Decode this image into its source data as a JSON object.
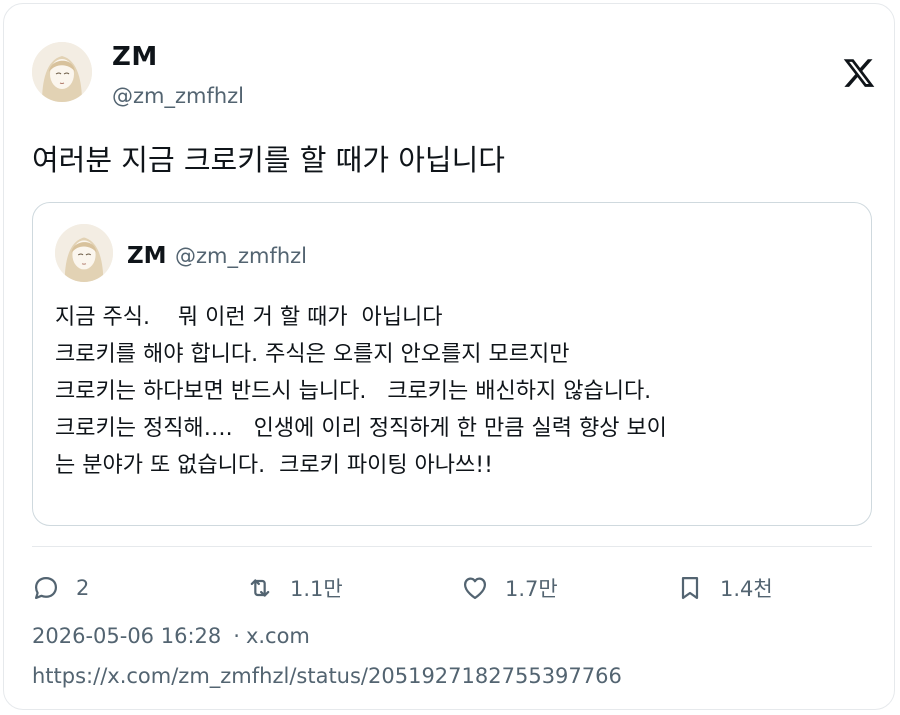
{
  "tweet": {
    "author_name": "ZM",
    "author_handle": "@zm_zmfhzl",
    "text": "여러분 지금 크로키를 할 때가 아닙니다"
  },
  "quote": {
    "author_name": "ZM",
    "author_handle": "@zm_zmfhzl",
    "lines": [
      "지금 주식.    뭐 이런 거 할 때가  아닙니다",
      "크로키를 해야 합니다. 주식은 오를지 안오를지 모르지만",
      "크로키는 하다보면 반드시 늡니다.   크로키는 배신하지 않습니다.",
      "크로키는 정직해….   인생에 이리 정직하게 한 만큼 실력 향상 보이",
      "는 분야가 또 없습니다.  크로키 파이팅 아나쓰!!"
    ]
  },
  "actions": {
    "replies": "2",
    "retweets": "1.1만",
    "likes": "1.7만",
    "bookmarks": "1.4천"
  },
  "meta": {
    "timestamp": "2026-05-06 16:28",
    "separator": "·",
    "source": "x.com"
  },
  "url": "https://x.com/zm_zmfhzl/status/2051927182755397766",
  "icons": {
    "logo": "x-logo-icon",
    "reply": "reply-icon",
    "retweet": "retweet-icon",
    "like": "heart-icon",
    "bookmark": "bookmark-icon"
  },
  "colors": {
    "text": "#0f1419",
    "secondary": "#536471",
    "border": "#cfd9de"
  }
}
